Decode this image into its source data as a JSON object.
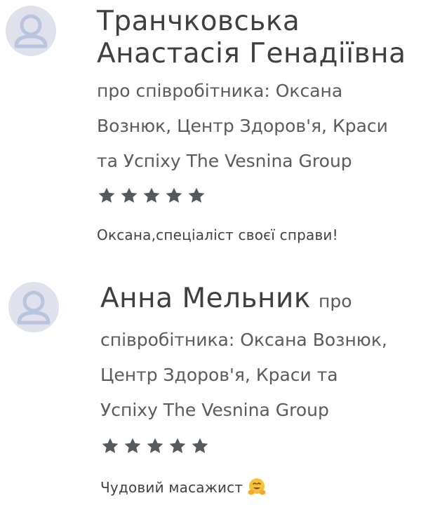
{
  "reviews": [
    {
      "name_lines": [
        "Транчковська",
        "Анастасія Генадіївна"
      ],
      "about_lines": [
        "про співробітника: Оксана",
        "Вознюк, Центр Здоров'я, Краси",
        "та Успіху The Vesnina Group"
      ],
      "rating": 5,
      "rating_max": 5,
      "comment": "Оксана,спеціаліст своєї справи!",
      "avatar_icon": "user-avatar-icon"
    },
    {
      "name": "Анна Мельник",
      "about_inline": "про",
      "about_lines": [
        "співробітника: Оксана Вознюк,",
        "Центр Здоров'я, Краси та",
        "Успіху The Vesnina Group"
      ],
      "rating": 5,
      "rating_max": 5,
      "comment": "Чудовий масажист",
      "comment_emoji_icon": "hugging-face-emoji-icon",
      "avatar_icon": "user-avatar-icon"
    }
  ],
  "colors": {
    "star": "#555a60",
    "avatar_bg": "#dfe2ec",
    "avatar_figure": "#bcc7e0"
  }
}
